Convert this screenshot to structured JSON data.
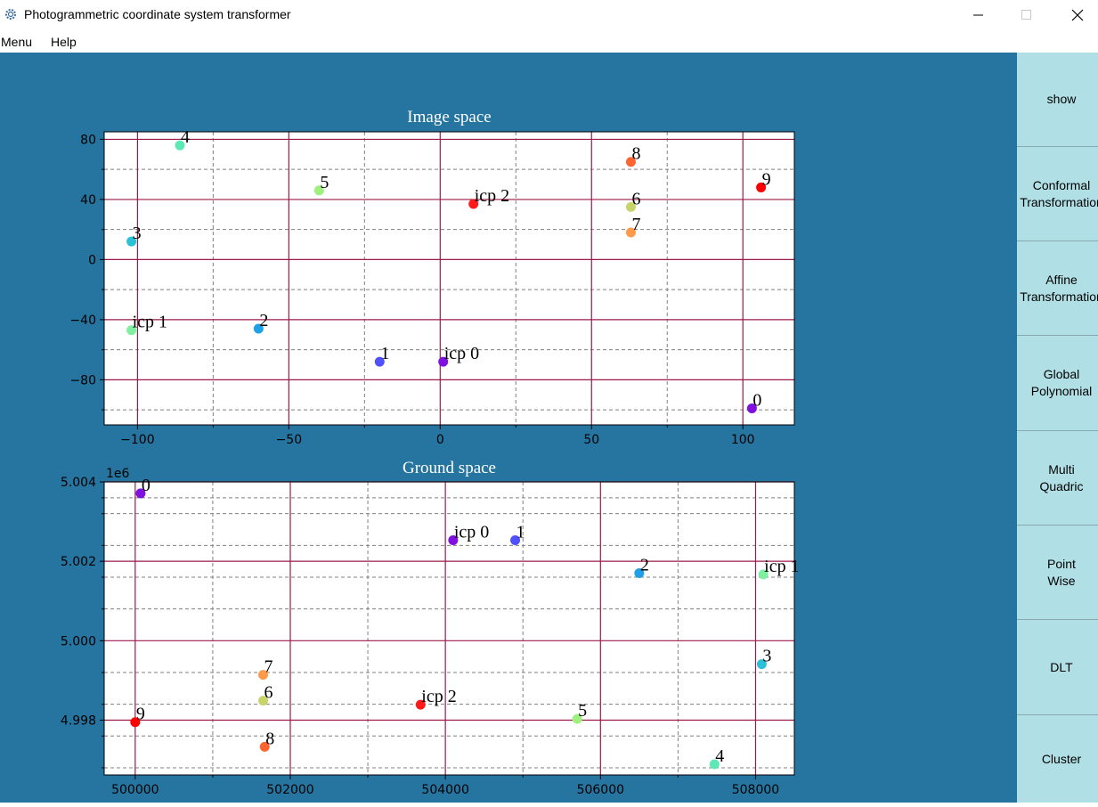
{
  "window": {
    "title": "Photogrammetric coordinate system transformer",
    "minimize_icon": "minimize-icon",
    "maximize_icon": "maximize-icon",
    "close_icon": "close-icon"
  },
  "menu": {
    "items": [
      "Menu",
      "Help"
    ]
  },
  "sidebar": {
    "buttons": [
      "show",
      "Conformal\nTransformation",
      "Affine\nTransformation",
      "Global\nPolynomial",
      "Multi\nQuadric",
      "Point\nWise",
      "DLT",
      "Cluster"
    ]
  },
  "colors": {
    "background": "#2674a0",
    "sidebar": "#b0e0e6",
    "major_grid": "#9b1a4a",
    "minor_grid": "#808080"
  },
  "chart_data": [
    {
      "type": "scatter",
      "title": "Image space",
      "xlim": [
        -111,
        117
      ],
      "ylim": [
        -110,
        85
      ],
      "x_major_ticks": [
        -100,
        -50,
        0,
        50,
        100
      ],
      "x_minor_ticks": [
        -75,
        -25,
        25,
        75
      ],
      "y_major_ticks": [
        80,
        40,
        0,
        -40,
        -80
      ],
      "y_minor_ticks": [
        60,
        20,
        -20,
        -60,
        -100
      ],
      "x_tick_labels": [
        "−100",
        "−50",
        "0",
        "50",
        "100"
      ],
      "y_tick_labels": [
        "80",
        "40",
        "0",
        "−40",
        "−80"
      ],
      "grid": true,
      "points": [
        {
          "label": "4",
          "x": -86,
          "y": 76,
          "color": "#5de8b5"
        },
        {
          "label": "5",
          "x": -40,
          "y": 46,
          "color": "#a0f080"
        },
        {
          "label": "8",
          "x": 63,
          "y": 65,
          "color": "#ff6530"
        },
        {
          "label": "9",
          "x": 106,
          "y": 48,
          "color": "#ff0000"
        },
        {
          "label": "icp 2",
          "x": 11,
          "y": 37,
          "color": "#ff1a1a"
        },
        {
          "label": "6",
          "x": 63,
          "y": 35,
          "color": "#c8d46a"
        },
        {
          "label": "7",
          "x": 63,
          "y": 18,
          "color": "#ff9a4a"
        },
        {
          "label": "3",
          "x": -102,
          "y": 12,
          "color": "#2ac0d8"
        },
        {
          "label": "icp 1",
          "x": -102,
          "y": -47,
          "color": "#7ef0a0"
        },
        {
          "label": "2",
          "x": -60,
          "y": -46,
          "color": "#20a0e6"
        },
        {
          "label": "1",
          "x": -20,
          "y": -68,
          "color": "#5050ff"
        },
        {
          "label": "icp 0",
          "x": 1,
          "y": -68,
          "color": "#8010e0"
        },
        {
          "label": "0",
          "x": 103,
          "y": -99,
          "color": "#8010e0"
        }
      ]
    },
    {
      "type": "scatter",
      "title": "Ground space",
      "offset_label": "1e6",
      "xlim": [
        499600,
        508500
      ],
      "ylim": [
        4.99662,
        5.004
      ],
      "x_major_ticks": [
        500000,
        502000,
        504000,
        506000,
        508000
      ],
      "x_minor_ticks": [
        501000,
        503000,
        505000,
        507000
      ],
      "y_major_ticks": [
        5.004,
        5.002,
        5.0,
        4.998
      ],
      "y_minor_ticks": [
        5.0036,
        5.0032,
        5.0024,
        5.0016,
        5.0008,
        4.9992,
        4.9984,
        4.9976,
        4.9968
      ],
      "x_tick_labels": [
        "500000",
        "502000",
        "504000",
        "506000",
        "508000"
      ],
      "y_tick_labels": [
        "5.004",
        "5.002",
        "5.000",
        "4.998"
      ],
      "grid": true,
      "points": [
        {
          "label": "0",
          "x": 500070,
          "y": 5.00371,
          "color": "#8010e0"
        },
        {
          "label": "icp 0",
          "x": 504100,
          "y": 5.00253,
          "color": "#8010e0"
        },
        {
          "label": "1",
          "x": 504900,
          "y": 5.00253,
          "color": "#5050ff"
        },
        {
          "label": "2",
          "x": 506500,
          "y": 5.0017,
          "color": "#20a0e6"
        },
        {
          "label": "icp 1",
          "x": 508100,
          "y": 5.00167,
          "color": "#7ef0a0"
        },
        {
          "label": "3",
          "x": 508080,
          "y": 4.99941,
          "color": "#2ac0d8"
        },
        {
          "label": "7",
          "x": 501650,
          "y": 4.99914,
          "color": "#ff9a4a"
        },
        {
          "label": "6",
          "x": 501650,
          "y": 4.99849,
          "color": "#c8d46a"
        },
        {
          "label": "icp 2",
          "x": 503680,
          "y": 4.99839,
          "color": "#ff1a1a"
        },
        {
          "label": "9",
          "x": 500000,
          "y": 4.99795,
          "color": "#ff0000"
        },
        {
          "label": "5",
          "x": 505700,
          "y": 4.99803,
          "color": "#a0f080"
        },
        {
          "label": "8",
          "x": 501670,
          "y": 4.99733,
          "color": "#ff6530"
        },
        {
          "label": "4",
          "x": 507470,
          "y": 4.99689,
          "color": "#5de8b5"
        }
      ]
    }
  ]
}
